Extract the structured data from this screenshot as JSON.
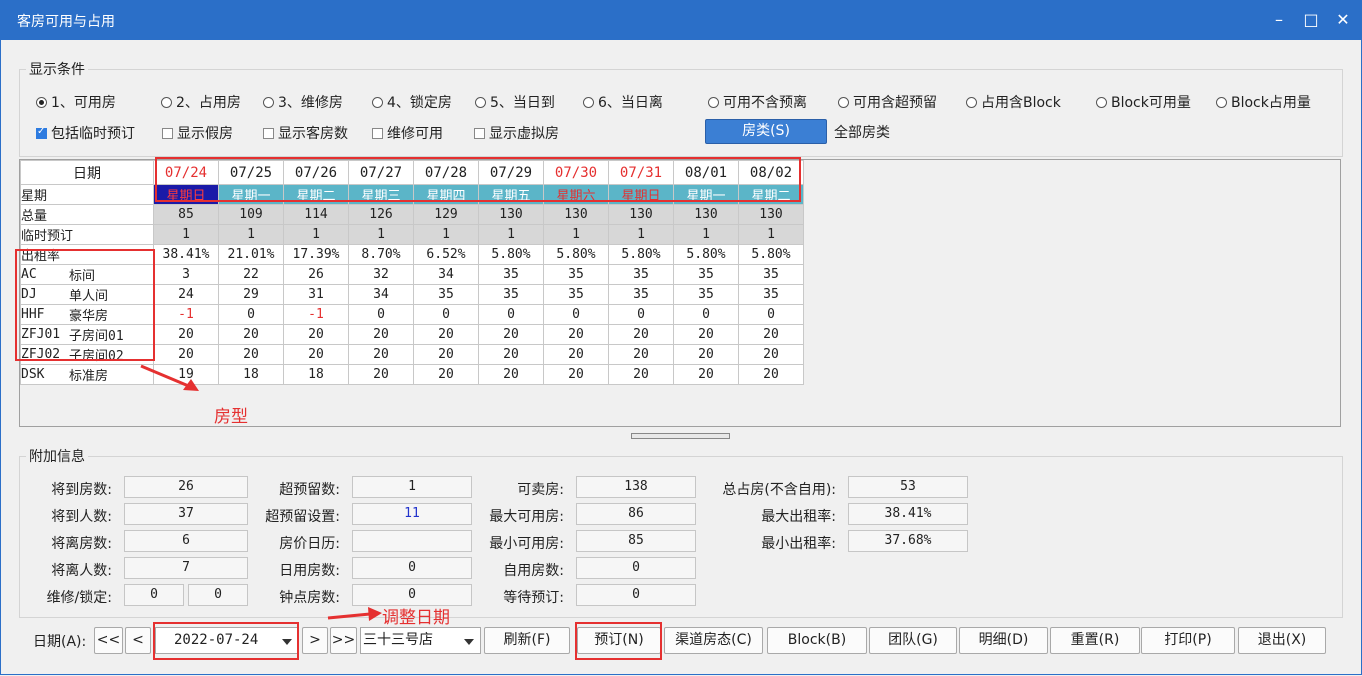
{
  "window": {
    "title": "客房可用与占用",
    "minimize": "–",
    "maximize": "□",
    "close": "✕"
  },
  "conditions": {
    "title": "显示条件",
    "radios": [
      {
        "label": "1、可用房",
        "checked": true
      },
      {
        "label": "2、占用房",
        "checked": false
      },
      {
        "label": "3、维修房",
        "checked": false
      },
      {
        "label": "4、锁定房",
        "checked": false
      },
      {
        "label": "5、当日到",
        "checked": false
      },
      {
        "label": "6、当日离",
        "checked": false
      },
      {
        "label": "可用不含预离",
        "checked": false
      },
      {
        "label": "可用含超预留",
        "checked": false
      },
      {
        "label": "占用含Block",
        "checked": false
      },
      {
        "label": "Block可用量",
        "checked": false
      },
      {
        "label": "Block占用量",
        "checked": false
      }
    ],
    "checks": [
      {
        "label": "包括临时预订",
        "checked": true
      },
      {
        "label": "显示假房",
        "checked": false
      },
      {
        "label": "显示客房数",
        "checked": false
      },
      {
        "label": "维修可用",
        "checked": false
      },
      {
        "label": "显示虚拟房",
        "checked": false
      }
    ],
    "room_type_button": "房类(S)",
    "room_type_value": "全部房类"
  },
  "grid": {
    "date_header": "日期",
    "dates": [
      "07/24",
      "07/25",
      "07/26",
      "07/27",
      "07/28",
      "07/29",
      "07/30",
      "07/31",
      "08/01",
      "08/02"
    ],
    "red_dates": [
      true,
      false,
      false,
      false,
      false,
      false,
      true,
      true,
      false,
      false
    ],
    "week_label": "星期",
    "weekdays": [
      "星期日",
      "星期一",
      "星期二",
      "星期三",
      "星期四",
      "星期五",
      "星期六",
      "星期日",
      "星期一",
      "星期二"
    ],
    "rows": [
      {
        "label": "总量",
        "values": [
          "85",
          "109",
          "114",
          "126",
          "129",
          "130",
          "130",
          "130",
          "130",
          "130"
        ],
        "gray": true
      },
      {
        "label": "临时预订",
        "values": [
          "1",
          "1",
          "1",
          "1",
          "1",
          "1",
          "1",
          "1",
          "1",
          "1"
        ],
        "gray": true
      },
      {
        "label": "出租率",
        "values": [
          "38.41%",
          "21.01%",
          "17.39%",
          "8.70%",
          "6.52%",
          "5.80%",
          "5.80%",
          "5.80%",
          "5.80%",
          "5.80%"
        ],
        "gray": false
      }
    ],
    "room_types": [
      {
        "code": "AC",
        "name": "标间",
        "values": [
          "3",
          "22",
          "26",
          "32",
          "34",
          "35",
          "35",
          "35",
          "35",
          "35"
        ]
      },
      {
        "code": "DJ",
        "name": "单人间",
        "values": [
          "24",
          "29",
          "31",
          "34",
          "35",
          "35",
          "35",
          "35",
          "35",
          "35"
        ]
      },
      {
        "code": "HHF",
        "name": "豪华房",
        "values": [
          "-1",
          "0",
          "-1",
          "0",
          "0",
          "0",
          "0",
          "0",
          "0",
          "0"
        ]
      },
      {
        "code": "ZFJ01",
        "name": "子房间01",
        "values": [
          "20",
          "20",
          "20",
          "20",
          "20",
          "20",
          "20",
          "20",
          "20",
          "20"
        ]
      },
      {
        "code": "ZFJ02",
        "name": "子房间02",
        "values": [
          "20",
          "20",
          "20",
          "20",
          "20",
          "20",
          "20",
          "20",
          "20",
          "20"
        ]
      },
      {
        "code": "DSK",
        "name": "标准房",
        "values": [
          "19",
          "18",
          "18",
          "20",
          "20",
          "20",
          "20",
          "20",
          "20",
          "20"
        ]
      }
    ]
  },
  "annotations": {
    "room_type": "房型",
    "adjust_date": "调整日期"
  },
  "extra": {
    "title": "附加信息",
    "col1": [
      {
        "label": "将到房数:",
        "value": "26"
      },
      {
        "label": "将到人数:",
        "value": "37"
      },
      {
        "label": "将离房数:",
        "value": "6"
      },
      {
        "label": "将离人数:",
        "value": "7"
      }
    ],
    "maint_label": "维修/锁定:",
    "maint_value": "0",
    "lock_value": "0",
    "col2": [
      {
        "label": "超预留数:",
        "value": "1"
      },
      {
        "label": "超预留设置:",
        "value": "11"
      },
      {
        "label": "房价日历:",
        "value": ""
      },
      {
        "label": "日用房数:",
        "value": "0"
      },
      {
        "label": "钟点房数:",
        "value": "0"
      }
    ],
    "col3": [
      {
        "label": "可卖房:",
        "value": "138"
      },
      {
        "label": "最大可用房:",
        "value": "86"
      },
      {
        "label": "最小可用房:",
        "value": "85"
      },
      {
        "label": "自用房数:",
        "value": "0"
      },
      {
        "label": "等待预订:",
        "value": "0"
      }
    ],
    "col4": [
      {
        "label": "总占房(不含自用):",
        "value": "53"
      },
      {
        "label": "最大出租率:",
        "value": "38.41%"
      },
      {
        "label": "最小出租率:",
        "value": "37.68%"
      }
    ]
  },
  "bottom": {
    "date_label": "日期(A):",
    "first": "<<",
    "prev": "<",
    "date_value": "2022-07-24",
    "next": ">",
    "last": ">>",
    "store": "三十三号店",
    "buttons": [
      "刷新(F)",
      "预订(N)",
      "渠道房态(C)",
      "Block(B)",
      "团队(G)",
      "明细(D)",
      "重置(R)",
      "打印(P)",
      "退出(X)"
    ]
  }
}
